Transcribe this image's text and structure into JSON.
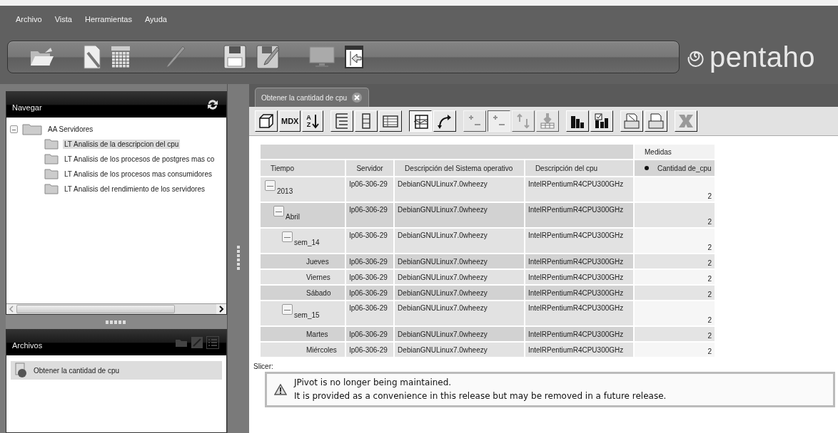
{
  "menu": [
    "Archivo",
    "Vista",
    "Herramientas",
    "Ayuda"
  ],
  "logo": {
    "text": "pentaho"
  },
  "navigator": {
    "title": "Navegar",
    "tree": [
      {
        "label": "AA Servidores",
        "expanded": true,
        "selected": false,
        "children": [
          {
            "label": "LT Analisis de la descripcion del cpu",
            "selected": true
          },
          {
            "label": "LT Analisis de los procesos de postgres mas co",
            "selected": false
          },
          {
            "label": "LT Analisis de los procesos mas consumidores",
            "selected": false
          },
          {
            "label": "LT Analisis del rendimiento de los servidores",
            "selected": false
          }
        ]
      }
    ]
  },
  "files": {
    "title": "Archivos",
    "items": [
      {
        "label": "Obtener la cantidad de cpu",
        "selected": true
      }
    ]
  },
  "tabs": [
    {
      "label": "Obtener la cantidad de cpu",
      "selected": true
    }
  ],
  "pivot_toolbar": [
    {
      "kind": "icon",
      "pressed": false,
      "disabled": false
    },
    {
      "kind": "text",
      "label": "MDX",
      "pressed": false,
      "disabled": false
    },
    {
      "kind": "icon",
      "letters": [
        "A",
        "Z"
      ],
      "pressed": false,
      "disabled": false
    },
    {
      "kind": "icon",
      "pressed": false,
      "disabled": false
    },
    {
      "kind": "icon",
      "pressed": false,
      "disabled": false
    },
    {
      "kind": "icon",
      "pressed": false,
      "disabled": false
    },
    {
      "kind": "icon",
      "pressed": true,
      "disabled": false
    },
    {
      "kind": "icon",
      "pressed": false,
      "disabled": false
    },
    {
      "kind": "icon",
      "pressed": false,
      "disabled": true
    },
    {
      "kind": "icon",
      "pressed": true,
      "disabled": true
    },
    {
      "kind": "icon",
      "pressed": false,
      "disabled": true
    },
    {
      "kind": "icon",
      "pressed": false,
      "disabled": true
    },
    {
      "kind": "icon",
      "pressed": false,
      "disabled": false
    },
    {
      "kind": "icon",
      "pressed": false,
      "disabled": false
    },
    {
      "kind": "icon",
      "pressed": false,
      "disabled": false
    },
    {
      "kind": "icon",
      "pressed": false,
      "disabled": false
    },
    {
      "kind": "icon",
      "pressed": false,
      "disabled": false
    }
  ],
  "table": {
    "group_header": "Medidas",
    "columns": [
      "Tiempo",
      "Servidor",
      "Descripción del Sistema operativo",
      "Descripción del cpu",
      "Cantidad de_cpu"
    ],
    "rows": [
      {
        "tiempo": "2013",
        "expanded": true,
        "servidor": "lp06-306-29",
        "so": "DebianGNULinux7.0wheezy",
        "cpu": "IntelRPentiumR4CPU300GHz",
        "cantidad": "2",
        "children": [
          {
            "tiempo": "Abril",
            "expanded": true,
            "servidor": "lp06-306-29",
            "so": "DebianGNULinux7.0wheezy",
            "cpu": "IntelRPentiumR4CPU300GHz",
            "cantidad": "2",
            "children": [
              {
                "tiempo": "sem_14",
                "expanded": true,
                "servidor": "lp06-306-29",
                "so": "DebianGNULinux7.0wheezy",
                "cpu": "IntelRPentiumR4CPU300GHz",
                "cantidad": "2",
                "children": [
                  {
                    "tiempo": "Jueves",
                    "servidor": "lp06-306-29",
                    "so": "DebianGNULinux7.0wheezy",
                    "cpu": "IntelRPentiumR4CPU300GHz",
                    "cantidad": "2"
                  },
                  {
                    "tiempo": "Viernes",
                    "servidor": "lp06-306-29",
                    "so": "DebianGNULinux7.0wheezy",
                    "cpu": "IntelRPentiumR4CPU300GHz",
                    "cantidad": "2"
                  },
                  {
                    "tiempo": "Sábado",
                    "servidor": "lp06-306-29",
                    "so": "DebianGNULinux7.0wheezy",
                    "cpu": "IntelRPentiumR4CPU300GHz",
                    "cantidad": "2"
                  }
                ]
              },
              {
                "tiempo": "sem_15",
                "expanded": true,
                "servidor": "lp06-306-29",
                "so": "DebianGNULinux7.0wheezy",
                "cpu": "IntelRPentiumR4CPU300GHz",
                "cantidad": "2",
                "children": [
                  {
                    "tiempo": "Martes",
                    "servidor": "lp06-306-29",
                    "so": "DebianGNULinux7.0wheezy",
                    "cpu": "IntelRPentiumR4CPU300GHz",
                    "cantidad": "2"
                  },
                  {
                    "tiempo": "Miércoles",
                    "servidor": "lp06-306-29",
                    "so": "DebianGNULinux7.0wheezy",
                    "cpu": "IntelRPentiumR4CPU300GHz",
                    "cantidad": "2"
                  }
                ]
              }
            ]
          }
        ]
      }
    ]
  },
  "slicer": "Slicer:",
  "warning": [
    "JPivot is no longer being maintained.",
    "It is provided as a convenience in this release but may be removed in a future release."
  ]
}
